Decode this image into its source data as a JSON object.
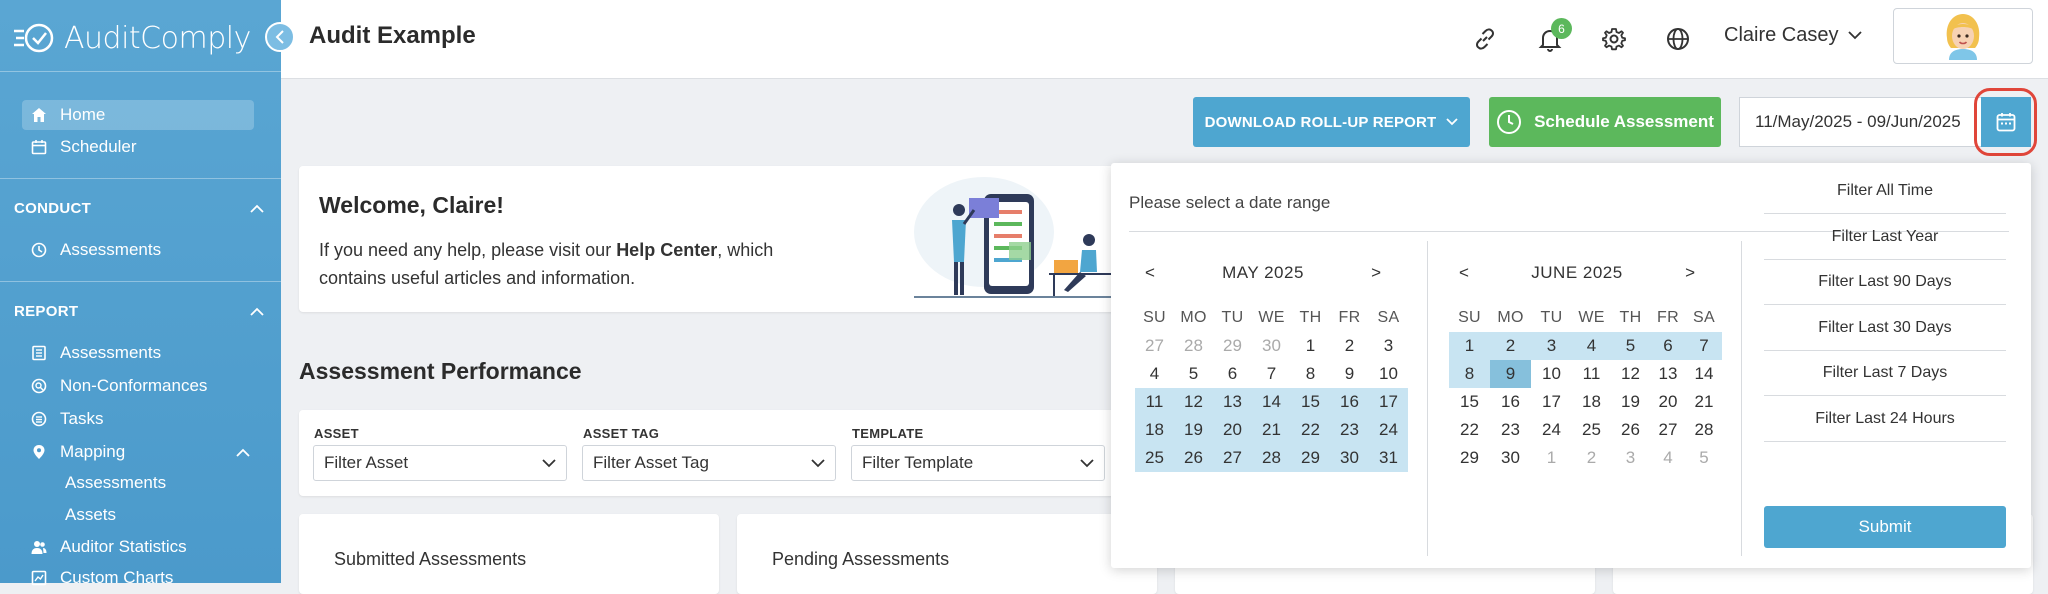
{
  "app": {
    "name": "AuditComply",
    "page_title": "Audit Example"
  },
  "sidebar": {
    "top_items": [
      {
        "label": "Home",
        "icon": "home-icon"
      },
      {
        "label": "Scheduler",
        "icon": "calendar-icon"
      }
    ],
    "conduct": {
      "header": "CONDUCT",
      "items": [
        {
          "label": "Assessments",
          "icon": "clock-icon"
        }
      ]
    },
    "report": {
      "header": "REPORT",
      "items": [
        {
          "label": "Assessments",
          "icon": "list-icon"
        },
        {
          "label": "Non-Conformances",
          "icon": "search-icon"
        },
        {
          "label": "Tasks",
          "icon": "tasks-icon"
        },
        {
          "label": "Mapping",
          "icon": "map-pin-icon"
        }
      ],
      "mapping_sub": [
        "Assessments",
        "Assets"
      ],
      "more_items": [
        {
          "label": "Auditor Statistics",
          "icon": "users-icon"
        },
        {
          "label": "Custom Charts",
          "icon": "chart-icon"
        }
      ]
    }
  },
  "header": {
    "notification_count": "6",
    "user_name": "Claire Casey"
  },
  "toolbar": {
    "download_label": "DOWNLOAD ROLL-UP REPORT",
    "schedule_label": "Schedule Assessment",
    "date_range": "11/May/2025 - 09/Jun/2025"
  },
  "welcome": {
    "title": "Welcome, Claire!",
    "text_before": "If you need any help, please visit our ",
    "link": "Help Center",
    "text_after": ", which contains useful articles and information."
  },
  "performance": {
    "title": "Assessment Performance",
    "filters": [
      {
        "label": "ASSET",
        "placeholder": "Filter Asset"
      },
      {
        "label": "ASSET TAG",
        "placeholder": "Filter Asset Tag"
      },
      {
        "label": "TEMPLATE",
        "placeholder": "Filter Template"
      }
    ],
    "cards": [
      "Submitted Assessments",
      "Pending Assessments"
    ]
  },
  "datepicker": {
    "prompt": "Please select a date range",
    "prev": "<",
    "next": ">",
    "weekdays": [
      "SU",
      "MO",
      "TU",
      "WE",
      "TH",
      "FR",
      "SA"
    ],
    "left_month": {
      "name": "MAY 2025",
      "days": [
        "27",
        "28",
        "29",
        "30",
        "1",
        "2",
        "3",
        "4",
        "5",
        "6",
        "7",
        "8",
        "9",
        "10",
        "11",
        "12",
        "13",
        "14",
        "15",
        "16",
        "17",
        "18",
        "19",
        "20",
        "21",
        "22",
        "23",
        "24",
        "25",
        "26",
        "27",
        "28",
        "29",
        "30",
        "31"
      ],
      "muted": [
        0,
        1,
        2,
        3
      ],
      "selected": [
        14,
        15,
        16,
        17,
        18,
        19,
        20,
        21,
        22,
        23,
        24,
        25,
        26,
        27,
        28,
        29,
        30,
        31,
        32,
        33,
        34
      ],
      "current": []
    },
    "right_month": {
      "name": "JUNE 2025",
      "days": [
        "1",
        "2",
        "3",
        "4",
        "5",
        "6",
        "7",
        "8",
        "9",
        "10",
        "11",
        "12",
        "13",
        "14",
        "15",
        "16",
        "17",
        "18",
        "19",
        "20",
        "21",
        "22",
        "23",
        "24",
        "25",
        "26",
        "27",
        "28",
        "29",
        "30",
        "1",
        "2",
        "3",
        "4",
        "5"
      ],
      "muted": [
        30,
        31,
        32,
        33,
        34
      ],
      "selected": [
        0,
        1,
        2,
        3,
        4,
        5,
        6,
        7
      ],
      "current": [
        8
      ]
    },
    "quick_filters": [
      "Filter All Time",
      "Filter Last Year",
      "Filter Last 90 Days",
      "Filter Last 30 Days",
      "Filter Last 7 Days",
      "Filter Last 24 Hours"
    ],
    "submit_label": "Submit"
  },
  "colors": {
    "accent": "#4ea6d0",
    "success": "#5cb85c",
    "highlight_ring": "#e0463a"
  }
}
